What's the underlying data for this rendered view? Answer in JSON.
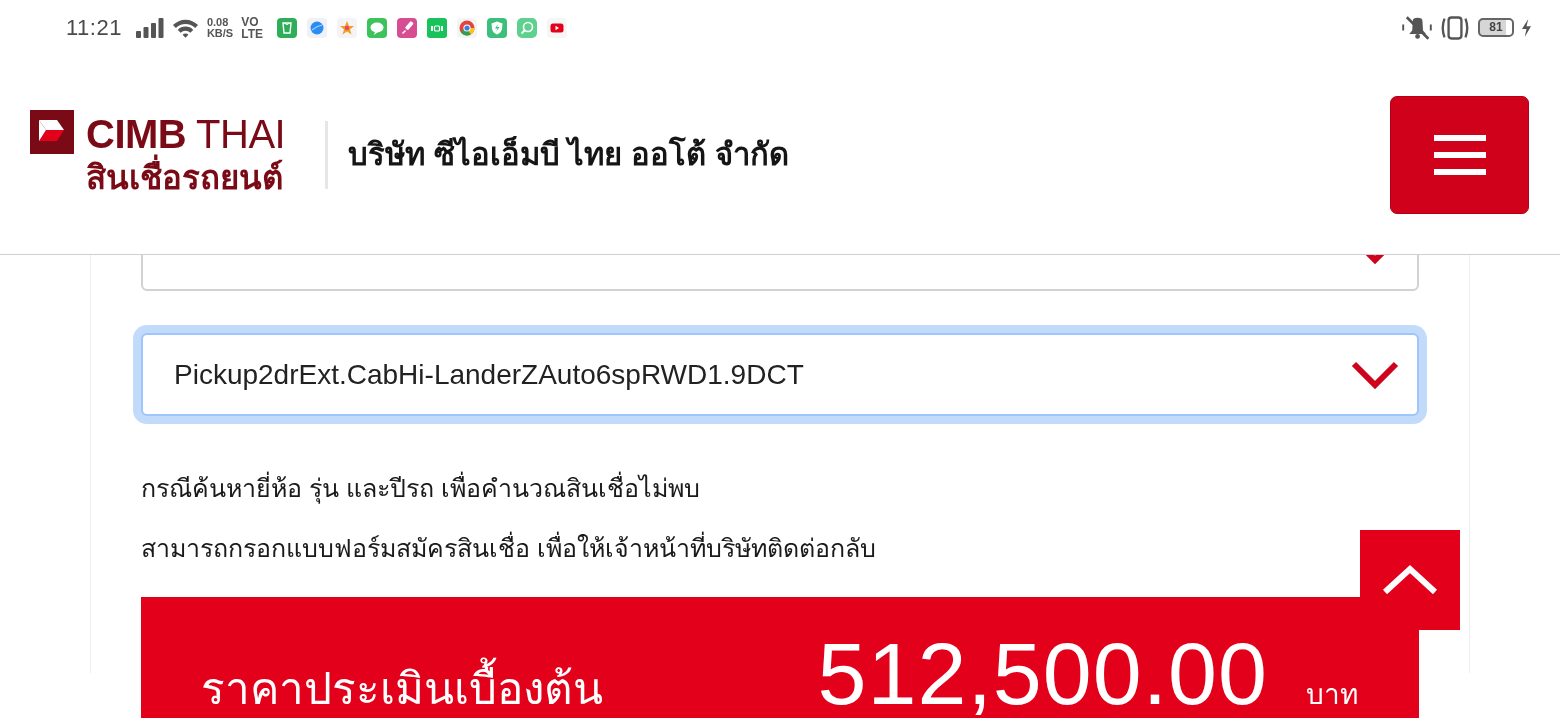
{
  "status_bar": {
    "time": "11:21",
    "data_rate": {
      "value": "0.08",
      "unit": "KB/S"
    },
    "network": {
      "line_1": "VO",
      "line_2": "LTE"
    },
    "notification_icons": [
      {
        "kind": "bag"
      },
      {
        "kind": "sphere"
      },
      {
        "kind": "star"
      },
      {
        "kind": "bubble"
      },
      {
        "kind": "brush"
      },
      {
        "kind": "tile"
      },
      {
        "kind": "wheel"
      },
      {
        "kind": "shield"
      },
      {
        "kind": "orb"
      },
      {
        "kind": "play"
      }
    ],
    "battery": "81"
  },
  "header": {
    "logo": {
      "brand": "**CIMB** THAI",
      "tagline": "สินเชื่อรถยนต์"
    },
    "company_name": "บริษัท ซีไอเอ็มบี ไทย ออโต้ จำกัด"
  },
  "form": {
    "selects": [
      {
        "focused": false
      },
      {
        "value": "Pickup2drExt.CabHi-LanderZAuto6spRWD1.9DCT",
        "focused": true
      }
    ]
  },
  "notice": {
    "lines": [
      "กรณีค้นหายี่ห้อ รุ่น และปีรถ เพื่อคำนวณสินเชื่อไม่พบ",
      "สามารถกรอกแบบฟอร์มสมัครสินเชื่อ เพื่อให้เจ้าหน้าที่บริษัทติดต่อกลับ"
    ]
  },
  "estimate": {
    "label": "ราคาประเมินเบื้องต้น",
    "amount": "512,500.00",
    "unit": "บาท"
  }
}
